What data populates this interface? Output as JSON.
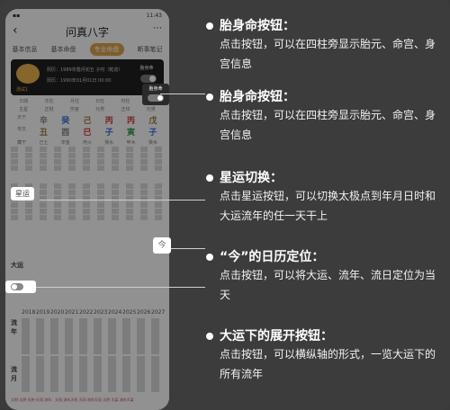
{
  "phone": {
    "status_right": "11:43",
    "nav_title": "问真八字",
    "tabs": [
      "基本信息",
      "基本命盘",
      "专业命盘",
      "断事笔记"
    ],
    "card": {
      "line1": "阴历：1989年腊月初五 子时（乾造）",
      "line2": "阳历：1990年01月01日 00:00",
      "sub": "测试1",
      "toggle_label": "胎身命"
    },
    "pillar_headers": [
      "日期",
      "年柱",
      "月柱",
      "日柱",
      "时柱",
      "日元"
    ],
    "row_shishen": [
      "主星",
      "正财",
      "伤官",
      "元男",
      "正印",
      "元男"
    ],
    "row_tiangan": [
      "天干",
      "辛",
      "癸",
      "己",
      "丙",
      "丙",
      "戊"
    ],
    "row_dizhi": [
      "地支",
      "丑",
      "酉",
      "巳",
      "子",
      "寅",
      "子"
    ],
    "row_canggan": [
      "藏干",
      "己土",
      "辛金",
      "丙火",
      "癸水",
      "甲木",
      "癸水"
    ],
    "yun_label": "星运",
    "years": [
      "2018",
      "2019",
      "2020",
      "2021",
      "2022",
      "2023",
      "2024",
      "2025",
      "2026",
      "2027"
    ],
    "dayun_label": "大运",
    "liunian_label": "流年",
    "liuyue_label": "流月",
    "today_glyph": "今",
    "footer": "太阳·太阴·天府·天同 流年：天机 流年天机 天同 流年天同 太阴 天梁 流年天梁"
  },
  "annotations": [
    {
      "title": "胎身命按钮：",
      "body": "点击按钮，可以在四柱旁显示胎元、命宫、身宫信息"
    },
    {
      "title": "胎身命按钮：",
      "body": "点击按钮，可以在四柱旁显示胎元、命宫、身宫信息"
    },
    {
      "title": "星运切换：",
      "body": "点击星运按钮，可以切换太极点到年月日时和大运流年的任一天干上"
    },
    {
      "title": "“今”的日历定位：",
      "body": "点击按钮，可以将大运、流年、流日定位为当天"
    },
    {
      "title": "大运下的展开按钮：",
      "body": "点击按钮，可以横纵轴的形式，一览大运下的所有流年"
    }
  ],
  "colors": {
    "accent": "#d8a24a",
    "background": "#3c3c3c"
  }
}
